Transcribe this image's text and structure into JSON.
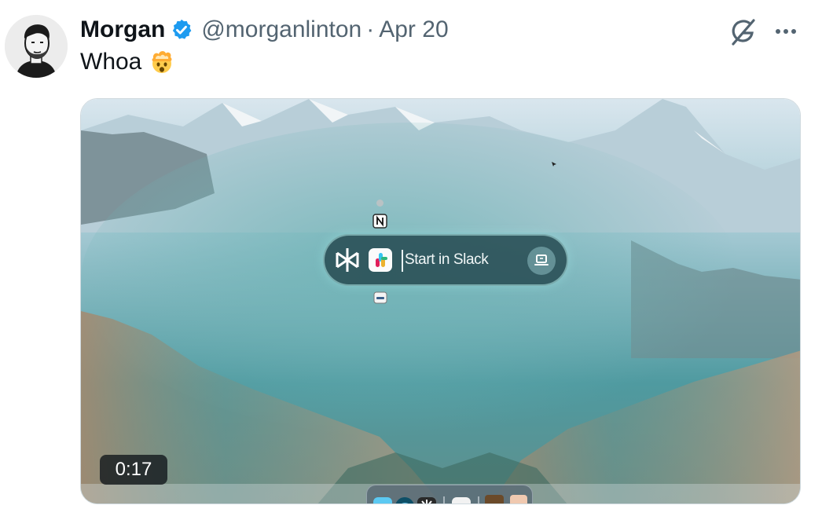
{
  "tweet": {
    "author_name": "Morgan",
    "handle": "@morganlinton",
    "separator": "·",
    "date": "Apr 20",
    "text": "Whoa",
    "emoji_icon": "exploding-head-emoji"
  },
  "media": {
    "type": "video",
    "duration": "0:17",
    "spotlight_text": "Start in Slack",
    "icons": [
      "perplexity-icon",
      "slack-icon",
      "notion-icon",
      "laptop-icon"
    ]
  },
  "colors": {
    "text_primary": "#0f1419",
    "text_secondary": "#536471",
    "verified_blue": "#1d9bf0"
  }
}
